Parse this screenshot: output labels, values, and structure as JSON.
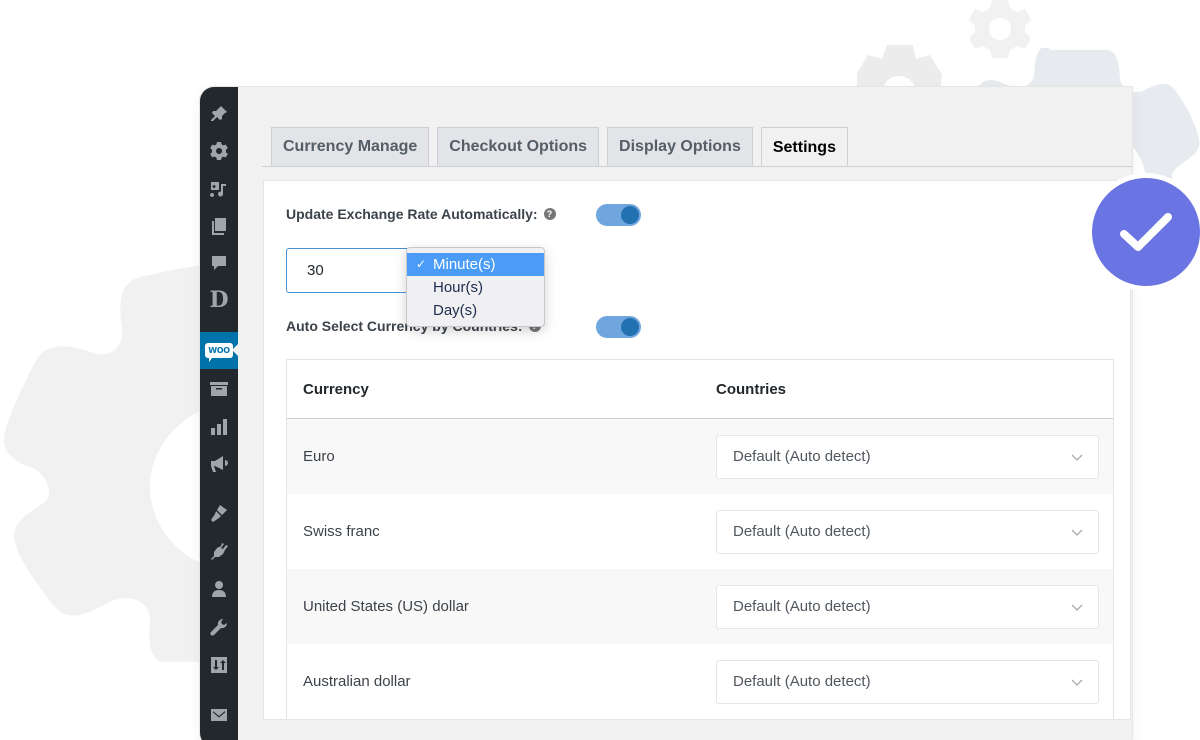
{
  "sidebar": {
    "items": [
      {
        "id": "posts",
        "icon": "pin-icon"
      },
      {
        "id": "settings",
        "icon": "gear-icon"
      },
      {
        "id": "media",
        "icon": "media-icon"
      },
      {
        "id": "pages",
        "icon": "pages-icon"
      },
      {
        "id": "comments",
        "icon": "comment-icon"
      },
      {
        "id": "divi",
        "icon": "d-logo-icon",
        "label": "D"
      },
      {
        "id": "woocommerce",
        "icon": "woo-icon",
        "label": "woo",
        "active": true
      },
      {
        "id": "products",
        "icon": "archive-icon"
      },
      {
        "id": "analytics",
        "icon": "bar-chart-icon"
      },
      {
        "id": "marketing",
        "icon": "megaphone-icon"
      },
      {
        "id": "appearance",
        "icon": "paintbrush-icon"
      },
      {
        "id": "plugins",
        "icon": "plug-icon"
      },
      {
        "id": "users",
        "icon": "user-icon"
      },
      {
        "id": "tools",
        "icon": "wrench-icon"
      },
      {
        "id": "adjust",
        "icon": "sliders-icon"
      },
      {
        "id": "mail",
        "icon": "mail-icon"
      }
    ]
  },
  "tabs": [
    {
      "label": "Currency Manage",
      "active": false
    },
    {
      "label": "Checkout Options",
      "active": false
    },
    {
      "label": "Display Options",
      "active": false
    },
    {
      "label": "Settings",
      "active": true
    }
  ],
  "settings": {
    "update_rate_label": "Update Exchange Rate Automatically:",
    "update_rate_enabled": true,
    "interval_value": "30",
    "interval_unit_options": [
      "Minute(s)",
      "Hour(s)",
      "Day(s)"
    ],
    "interval_unit_selected": "Minute(s)",
    "auto_select_label": "Auto Select Currency by Countries:",
    "auto_select_enabled": true,
    "help_glyph": "?",
    "check_glyph": "✓"
  },
  "table": {
    "headers": [
      "Currency",
      "Countries"
    ],
    "rows": [
      {
        "currency": "Euro",
        "countries": "Default (Auto detect)"
      },
      {
        "currency": "Swiss franc",
        "countries": "Default (Auto detect)"
      },
      {
        "currency": "United States (US) dollar",
        "countries": "Default (Auto detect)"
      },
      {
        "currency": "Australian dollar",
        "countries": "Default (Auto detect)"
      }
    ]
  },
  "colors": {
    "accent": "#0073aa",
    "toggle_track": "#6fa6dd",
    "toggle_knob": "#2271b1",
    "badge": "#6b74e3",
    "sidebar_bg": "#23282d"
  }
}
